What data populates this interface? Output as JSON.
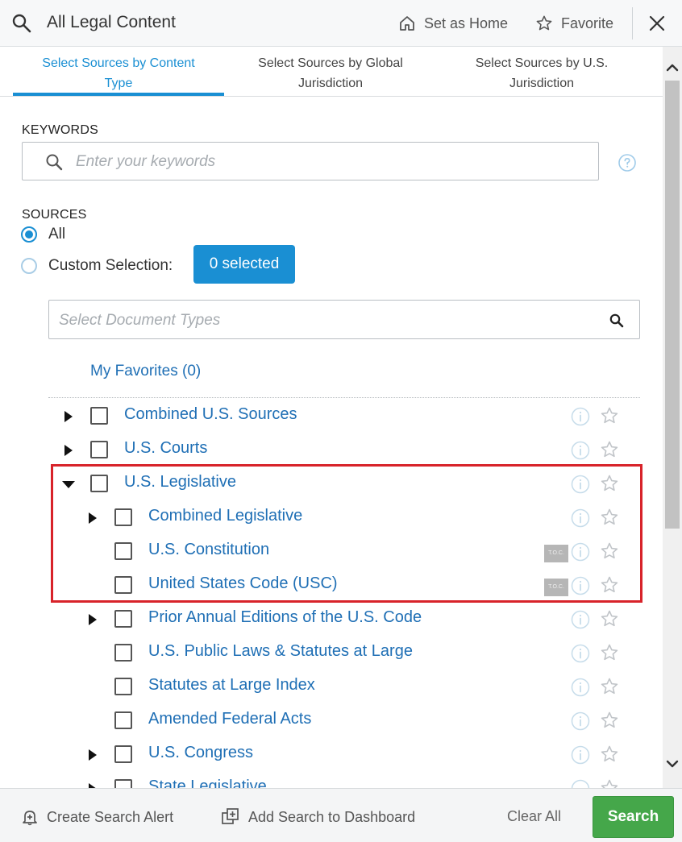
{
  "header": {
    "title": "All Legal Content",
    "set_home_label": "Set as Home",
    "favorite_label": "Favorite"
  },
  "tabs": [
    {
      "label_line1": "Select Sources by Content",
      "label_line2": "Type",
      "active": true
    },
    {
      "label_line1": "Select Sources by Global",
      "label_line2": "Jurisdiction",
      "active": false
    },
    {
      "label_line1": "Select Sources by U.S.",
      "label_line2": "Jurisdiction",
      "active": false
    }
  ],
  "keywords": {
    "label": "KEYWORDS",
    "value": "",
    "placeholder": "Enter your keywords"
  },
  "sources": {
    "label": "SOURCES",
    "options": [
      {
        "label": "All",
        "checked": true
      },
      {
        "label": "Custom Selection:",
        "checked": false
      }
    ],
    "selected_button": "0 selected",
    "doc_types_placeholder": "Select Document Types",
    "my_favorites": "My Favorites (0)"
  },
  "tree": [
    {
      "label": "Combined U.S. Sources",
      "level": 0,
      "caret": "right",
      "toc": false
    },
    {
      "label": "U.S. Courts",
      "level": 0,
      "caret": "right",
      "toc": false
    },
    {
      "label": "U.S. Legislative",
      "level": 0,
      "caret": "down",
      "toc": false
    },
    {
      "label": "Combined Legislative",
      "level": 1,
      "caret": "right",
      "toc": false
    },
    {
      "label": "U.S. Constitution",
      "level": 1,
      "caret": "none",
      "toc": true
    },
    {
      "label": "United States Code (USC)",
      "level": 1,
      "caret": "none",
      "toc": true
    },
    {
      "label": "Prior Annual Editions of the U.S. Code",
      "level": 1,
      "caret": "right",
      "toc": false
    },
    {
      "label": "U.S. Public Laws & Statutes at Large",
      "level": 1,
      "caret": "none",
      "toc": false
    },
    {
      "label": "Statutes at Large Index",
      "level": 1,
      "caret": "none",
      "toc": false
    },
    {
      "label": "Amended Federal Acts",
      "level": 1,
      "caret": "none",
      "toc": false
    },
    {
      "label": "U.S. Congress",
      "level": 1,
      "caret": "right",
      "toc": false
    },
    {
      "label": "State Legislative",
      "level": 1,
      "caret": "right",
      "toc": false
    }
  ],
  "toc_badge": "T.O.C.",
  "footer": {
    "create_alert": "Create Search Alert",
    "add_dashboard": "Add Search to Dashboard",
    "clear_all": "Clear All",
    "search": "Search"
  },
  "colors": {
    "accent": "#1a8fd3",
    "link": "#1f6fb5",
    "search_button": "#45a74a",
    "highlight": "#d8232a"
  }
}
